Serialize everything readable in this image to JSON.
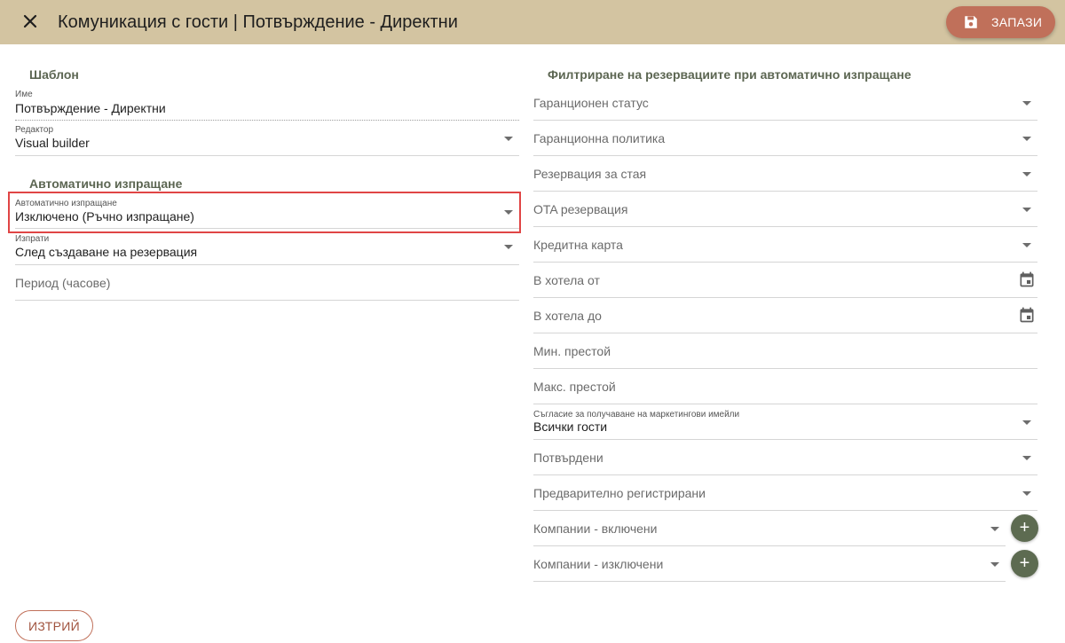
{
  "header": {
    "title": "Комуникация с гости | Потвърждение - Директни",
    "save_label": "ЗАПАЗИ"
  },
  "template_section": {
    "title": "Шаблон",
    "name": {
      "label": "Име",
      "value": "Потвърждение - Директни"
    },
    "editor": {
      "label": "Редактор",
      "value": "Visual builder"
    }
  },
  "auto_section": {
    "title": "Автоматично изпращане",
    "auto_send": {
      "label": "Автоматично изпращане",
      "value": "Изключено (Ръчно изпращане)"
    },
    "send": {
      "label": "Изпрати",
      "value": "След създаване на резервация"
    },
    "period": {
      "placeholder": "Период (часове)"
    }
  },
  "filter_section": {
    "title": "Филтриране на резервациите при автоматично изпращане",
    "guarantee_status": "Гаранционен статус",
    "guarantee_policy": "Гаранционна политика",
    "room_reservation": "Резервация за стая",
    "ota_reservation": "OTA резервация",
    "credit_card": "Кредитна карта",
    "in_hotel_from": "В хотела от",
    "in_hotel_to": "В хотела до",
    "min_stay": "Мин. престой",
    "max_stay": "Макс. престой",
    "marketing_consent": {
      "label": "Съгласие за получаване на маркетингови имейли",
      "value": "Всички гости"
    },
    "confirmed": "Потвърдени",
    "preregistered": "Предварително регистрирани",
    "companies_included": "Компании - включени",
    "companies_excluded": "Компании - изключени"
  },
  "footer": {
    "delete_label": "ИЗТРИЙ"
  },
  "icons": {
    "close": "close-icon",
    "save": "floppy-disk-icon",
    "dropdown": "caret-down-icon",
    "calendar": "calendar-icon",
    "add": "plus-icon"
  },
  "colors": {
    "header_bg": "#d3c4a1",
    "save_button": "#c0705a",
    "section_title": "#5c6652",
    "add_button": "#5d6b51",
    "highlight": "#e04545"
  }
}
